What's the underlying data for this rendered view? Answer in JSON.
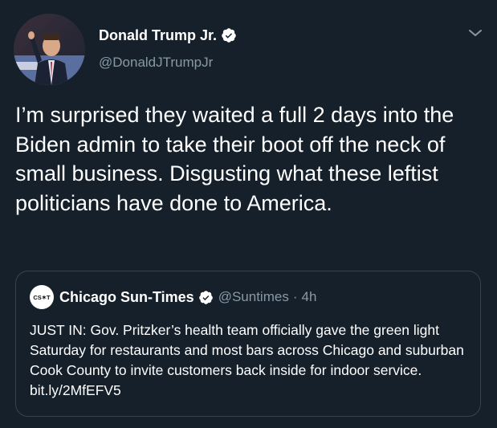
{
  "tweet": {
    "display_name": "Donald Trump Jr.",
    "handle": "@DonaldJTrumpJr",
    "text": "I’m surprised they waited a full 2 days into the Biden admin to take their boot off the neck of small business. Disgusting what these leftist politicians have done to America.",
    "verified_icon": "verified-badge-icon",
    "menu_icon": "chevron-down-icon"
  },
  "quoted_tweet": {
    "avatar_text": "CS✶T",
    "display_name": "Chicago Sun-Times",
    "handle": "@Suntimes",
    "separator": "·",
    "time": "4h",
    "text": "JUST IN: Gov. Pritzker’s health team officially gave the green light Saturday for restaurants and most bars across Chicago and suburban Cook County to invite customers back inside for indoor service. bit.ly/2MfEFV5"
  },
  "colors": {
    "background": "#15202b",
    "text": "#ffffff",
    "secondary_text": "#8899a6",
    "border": "#38444d",
    "verified": "#ffffff"
  }
}
